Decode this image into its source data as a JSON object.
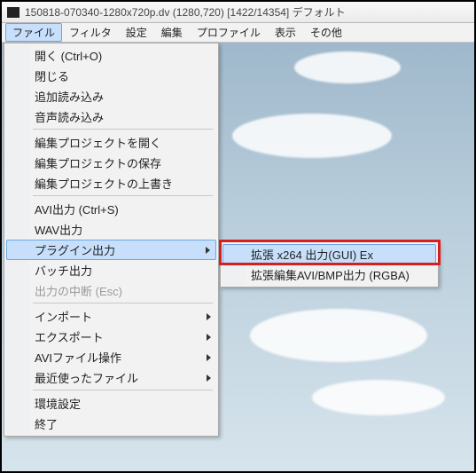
{
  "title": "150818-070340-1280x720p.dv (1280,720) [1422/14354] デフォルト",
  "menubar": {
    "file": "ファイル",
    "filter": "フィルタ",
    "config": "設定",
    "edit": "編集",
    "profile": "プロファイル",
    "view": "表示",
    "other": "その他"
  },
  "dropdown": {
    "open": "開く (Ctrl+O)",
    "close": "閉じる",
    "add_read": "追加読み込み",
    "audio_read": "音声読み込み",
    "proj_open": "編集プロジェクトを開く",
    "proj_save": "編集プロジェクトの保存",
    "proj_overw": "編集プロジェクトの上書き",
    "avi_out": "AVI出力 (Ctrl+S)",
    "wav_out": "WAV出力",
    "plugin_out": "プラグイン出力",
    "batch_out": "バッチ出力",
    "abort_out": "出力の中断 (Esc)",
    "import": "インポート",
    "export": "エクスポート",
    "avi_ops": "AVIファイル操作",
    "recent": "最近使ったファイル",
    "env": "環境設定",
    "exit": "終了"
  },
  "submenu": {
    "x264": "拡張 x264 出力(GUI) Ex",
    "rgba": "拡張編集AVI/BMP出力 (RGBA)"
  }
}
